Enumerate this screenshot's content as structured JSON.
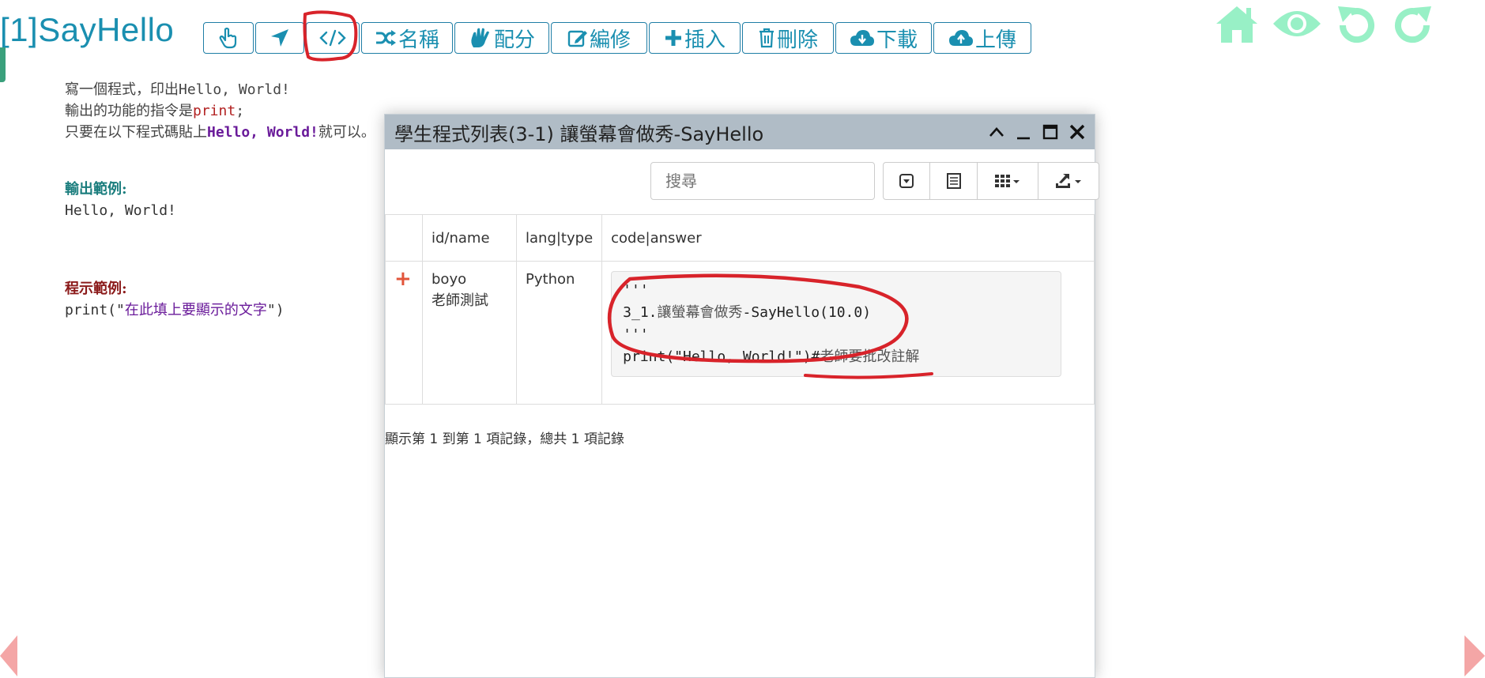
{
  "page": {
    "title": "[1]SayHello"
  },
  "toolbar": {
    "buttons": [
      {
        "icon": "hand-pointer-icon",
        "label": ""
      },
      {
        "icon": "location-arrow-icon",
        "label": ""
      },
      {
        "icon": "code-icon",
        "label": ""
      },
      {
        "icon": "shuffle-icon",
        "label": "名稱"
      },
      {
        "icon": "hand-spread-icon",
        "label": "配分"
      },
      {
        "icon": "edit-icon",
        "label": "編修"
      },
      {
        "icon": "plus-icon",
        "label": "插入"
      },
      {
        "icon": "trash-icon",
        "label": "刪除"
      },
      {
        "icon": "cloud-download-icon",
        "label": "下載"
      },
      {
        "icon": "cloud-upload-icon",
        "label": "上傳"
      }
    ]
  },
  "top_right_icons": [
    "home-icon",
    "eye-icon",
    "undo-icon",
    "redo-icon"
  ],
  "colors": {
    "accent": "#1a8fb0",
    "top_icons": "#98f0c6",
    "annotation": "#d8232a",
    "modal_header": "#b0bcc6",
    "nav_arrow": "#f4a6a6"
  },
  "description": {
    "line1_prefix": "寫一個程式，印出",
    "line1_code": "Hello, World!",
    "line2_prefix": "輸出的功能的指令是",
    "line2_code": "print",
    "line2_suffix": ";",
    "line3_prefix": "只要在以下程式碼貼上",
    "line3_code": "Hello, World!",
    "line3_suffix": "就可以。"
  },
  "output_example": {
    "heading": "輸出範例:",
    "text": "Hello, World!"
  },
  "program_example": {
    "heading": "程示範例:",
    "code_prefix": "print(\"",
    "code_string": "在此填上要顯示的文字",
    "code_suffix": "\")"
  },
  "modal": {
    "title": "學生程式列表(3-1) 讓螢幕會做秀-SayHello",
    "search_placeholder": "搜尋",
    "columns": [
      "",
      "id/name",
      "lang|type",
      "code|answer"
    ],
    "rows": [
      {
        "expand": "+",
        "id": "boyo",
        "name": "老師測試",
        "lang": "Python",
        "code_line1": "'''",
        "code_line2_prefix": "3_1.",
        "code_line2_cjk": "讓螢幕會做秀",
        "code_line2_suffix": "-SayHello(10.0)",
        "code_line3": "'''",
        "code_line4": "print(\"Hello, World!\")#",
        "code_line4_comment": "老師要批改註解"
      }
    ],
    "footer": "顯示第 1 到第 1 項記錄，總共 1 項記錄"
  }
}
